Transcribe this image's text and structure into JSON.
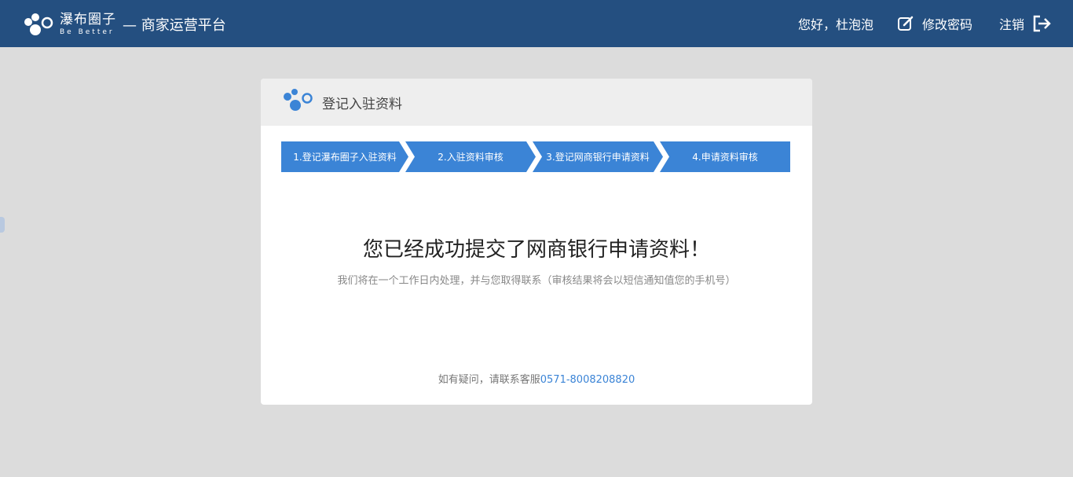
{
  "header": {
    "brand_name": "瀑布圈子",
    "brand_slogan": "Be Better",
    "platform_title": "— 商家运营平台",
    "greeting": "您好，杜泡泡",
    "change_password_label": "修改密码",
    "logout_label": "注销",
    "logo_icon": "bubbles-logo-icon",
    "edit_icon": "edit-icon",
    "logout_icon": "logout-icon"
  },
  "card": {
    "title": "登记入驻资料",
    "steps": [
      {
        "label": "1.登记瀑布圈子入驻资料"
      },
      {
        "label": "2.入驻资料审核"
      },
      {
        "label": "3.登记网商银行申请资料"
      },
      {
        "label": "4.申请资料审核"
      }
    ],
    "success_title": "您已经成功提交了网商银行申请资料！",
    "success_subtitle": "我们将在一个工作日内处理，并与您取得联系（审核结果将会以短信通知值您的手机号）",
    "help_prefix": "如有疑问，请联系客服",
    "help_phone": "0571-8008208820"
  },
  "colors": {
    "header_bg": "#244f80",
    "page_bg": "#dcdcdc",
    "accent": "#3b84d6"
  }
}
